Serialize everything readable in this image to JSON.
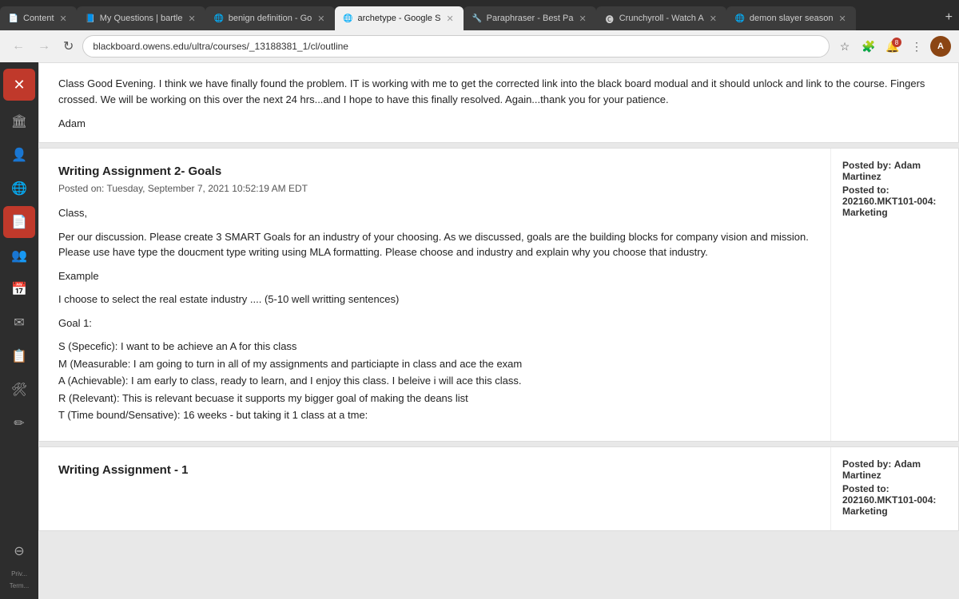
{
  "browser": {
    "tabs": [
      {
        "id": "tab-content",
        "label": "Content",
        "favicon": "📄",
        "active": false
      },
      {
        "id": "tab-myquestions",
        "label": "My Questions | bartle",
        "favicon": "📘",
        "active": false
      },
      {
        "id": "tab-benign",
        "label": "benign definition - Go",
        "favicon": "🌐",
        "active": false
      },
      {
        "id": "tab-archetype",
        "label": "archetype - Google S",
        "favicon": "🌐",
        "active": true
      },
      {
        "id": "tab-paraphraser",
        "label": "Paraphraser - Best Pa",
        "favicon": "🔧",
        "active": false
      },
      {
        "id": "tab-crunchyroll",
        "label": "Crunchyroll - Watch A",
        "favicon": "🅒",
        "active": false
      },
      {
        "id": "tab-demonslayer",
        "label": "demon slayer season",
        "favicon": "🌐",
        "active": false
      }
    ],
    "address": "blackboard.owens.edu/ultra/courses/_13188381_1/cl/outline",
    "new_tab_label": "+"
  },
  "sidebar": {
    "items": [
      {
        "id": "close",
        "icon": "✕",
        "active": false,
        "is_close": true
      },
      {
        "id": "institution",
        "icon": "🏛",
        "active": false
      },
      {
        "id": "user",
        "icon": "👤",
        "active": false
      },
      {
        "id": "globe",
        "icon": "🌐",
        "active": false
      },
      {
        "id": "document",
        "icon": "📄",
        "active": true
      },
      {
        "id": "group",
        "icon": "👥",
        "active": false
      },
      {
        "id": "calendar",
        "icon": "📅",
        "active": false
      },
      {
        "id": "mail",
        "icon": "✉",
        "active": false
      },
      {
        "id": "notes",
        "icon": "📋",
        "active": false
      },
      {
        "id": "tools",
        "icon": "🛠",
        "active": false
      },
      {
        "id": "edit",
        "icon": "✏",
        "active": false
      }
    ],
    "bottom": [
      {
        "id": "help",
        "icon": "⊖"
      }
    ],
    "footer_labels": [
      "Priv...",
      "Term..."
    ]
  },
  "partial_post": {
    "body_lines": [
      "Class Good Evening.  I think we have finally found the problem.  IT is working with me to get the corrected link into the black board modual and it should",
      "unlock and link to the course.  Fingers crossed.  We will be working on this over the next 24 hrs...and I hope to have this finally resolved.   Again...thank",
      "you for your patience."
    ],
    "signature": "Adam"
  },
  "post1": {
    "title": "Writing Assignment 2- Goals",
    "date": "Posted on: Tuesday, September 7, 2021 10:52:19 AM EDT",
    "body": {
      "intro": "Class,",
      "paragraph1": "Per our discussion.  Please create 3 SMART Goals for an industry of your choosing.  As we discussed, goals are the building blocks for company vision and mission.  Please use have type the doucment type writing using MLA formatting.   Please choose and industry and explain why you choose that industry.",
      "example_label": "Example",
      "example_text": "I choose to select the real estate industry .... (5-10 well writting sentences)",
      "goal1_label": "Goal 1:",
      "goal_lines": [
        "S (Specefic):   I want to be achieve an A for this class",
        "M (Measurable:  I am going to turn in all of my assignments and particiapte in class and ace the exam",
        "A (Achievable):  I am early to class, ready to learn, and I enjoy this class.  I beleive i will ace this class.",
        "R (Relevant):  This is relevant becuase it supports  my bigger goal of making the deans list",
        "T  (Time bound/Sensative): 16 weeks - but taking it 1 class at a tme:"
      ]
    },
    "meta": {
      "posted_by_label": "Posted by:",
      "posted_by_value": "Adam Martinez",
      "posted_to_label": "Posted to:",
      "posted_to_value": "202160.MKT101-004: Marketing"
    }
  },
  "post2": {
    "title": "Writing Assignment - 1",
    "meta": {
      "posted_by_label": "Posted by:",
      "posted_by_value": "Adam Martinez",
      "posted_to_label": "Posted to:",
      "posted_to_value": "202160.MKT101-004: Marketing"
    }
  }
}
